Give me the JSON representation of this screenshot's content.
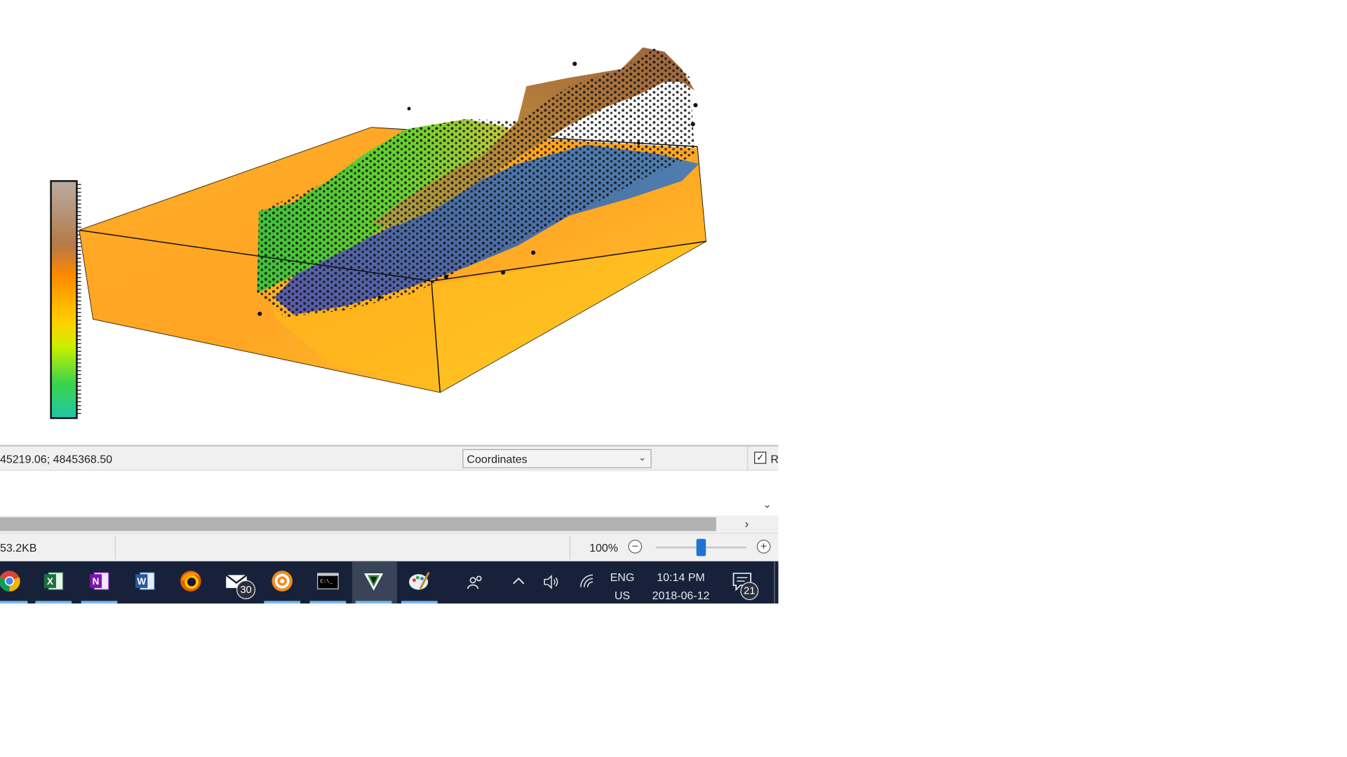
{
  "status_bar": {
    "coordinates_text": "45219.06; 4845368.50",
    "coordinate_mode": "Coordinates",
    "checkbox_label": "R",
    "checkbox_checked": true
  },
  "bottom_status": {
    "file_size": "53.2KB",
    "zoom_percent": "100%",
    "zoom_level_fraction": 0.5
  },
  "colorbar": {
    "gradient_colors": [
      "#b8aca3",
      "#b67946",
      "#ff8a00",
      "#ffd200",
      "#c9f000",
      "#3cd44a",
      "#1fc6a6"
    ]
  },
  "taskbar": {
    "apps": [
      {
        "name": "chrome-icon"
      },
      {
        "name": "excel-icon"
      },
      {
        "name": "onenote-icon"
      },
      {
        "name": "word-icon"
      },
      {
        "name": "firefox-icon"
      },
      {
        "name": "mail-icon",
        "badge": "30"
      },
      {
        "name": "settings-app-icon"
      },
      {
        "name": "terminal-icon"
      },
      {
        "name": "surfer-app-icon"
      },
      {
        "name": "paint-icon"
      }
    ],
    "language_top": "ENG",
    "language_bottom": "US",
    "time": "10:14 PM",
    "date": "2018-06-12",
    "notifications": "21"
  }
}
